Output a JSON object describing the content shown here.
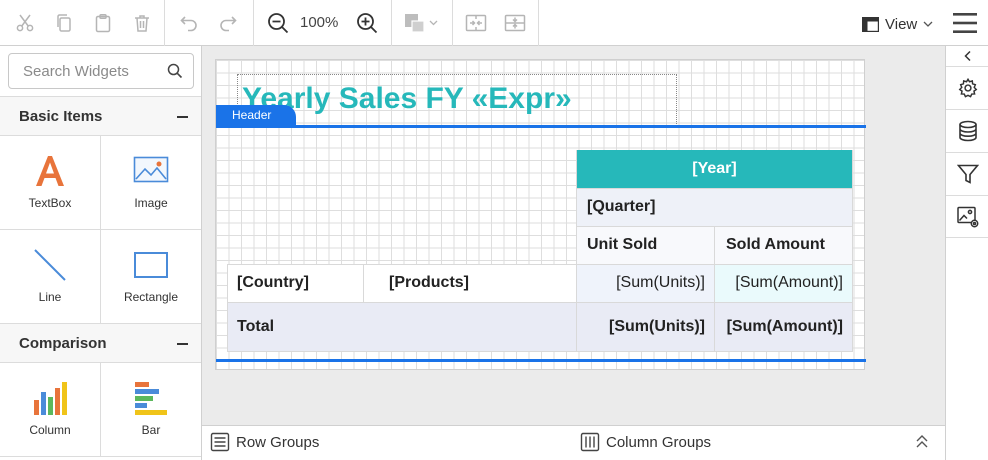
{
  "toolbar": {
    "zoom": "100%",
    "view_label": "View"
  },
  "left_panel": {
    "search_placeholder": "Search Widgets",
    "categories": [
      {
        "label": "Basic Items",
        "widgets": [
          "TextBox",
          "Image",
          "Line",
          "Rectangle"
        ]
      },
      {
        "label": "Comparison",
        "widgets": [
          "Column",
          "Bar"
        ]
      }
    ]
  },
  "report": {
    "title": "Yearly Sales FY «Expr»",
    "header_tab": "Header",
    "table": {
      "year": "[Year]",
      "quarter": "[Quarter]",
      "unit_sold": "Unit Sold",
      "sold_amount": "Sold Amount",
      "country": "[Country]",
      "products": "[Products]",
      "sum_units": "[Sum(Units)]",
      "sum_amount": "[Sum(Amount)]",
      "total": "Total",
      "total_units": "[Sum(Units)]",
      "total_amount": "[Sum(Amount)]"
    }
  },
  "bottom_bar": {
    "row_groups": "Row Groups",
    "column_groups": "Column Groups"
  },
  "colors": {
    "accent_blue": "#1a73e8",
    "teal": "#26b8ba",
    "icon_gray": "#b0b0b0"
  }
}
